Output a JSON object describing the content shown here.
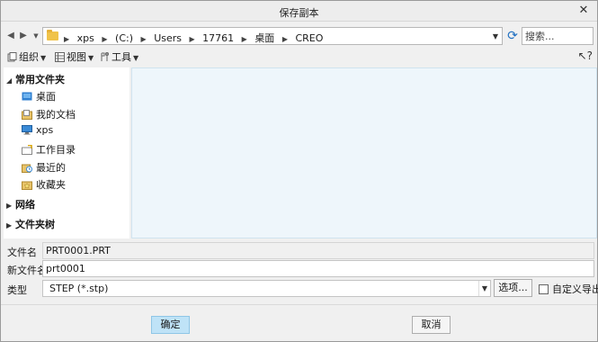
{
  "window": {
    "title": "保存副本",
    "close_glyph": "✕"
  },
  "address_bar": {
    "path": [
      "xps",
      "(C:)",
      "Users",
      "17761",
      "桌面",
      "CREO"
    ],
    "search_placeholder": "搜索..."
  },
  "toolbar": {
    "organize_label": "组织",
    "view_label": "视图",
    "tools_label": "工具"
  },
  "sidebar": {
    "favorites_label": "常用文件夹",
    "items": [
      {
        "label": "桌面",
        "icon": "desktop-icon"
      },
      {
        "label": "我的文档",
        "icon": "documents-icon"
      },
      {
        "label": "xps",
        "icon": "computer-icon"
      },
      {
        "label": "工作目录",
        "icon": "working-directory-icon"
      },
      {
        "label": "最近的",
        "icon": "recent-icon"
      },
      {
        "label": "收藏夹",
        "icon": "favorites-icon"
      }
    ],
    "network_label": "网络",
    "folder_tree_label": "文件夹树"
  },
  "form": {
    "filename_label": "文件名",
    "filename_value": "PRT0001.PRT",
    "new_filename_label": "新文件名",
    "new_filename_value": "prt0001",
    "type_label": "类型",
    "type_value": "STEP (*.stp)",
    "options_button": "选项...",
    "custom_export_label": "自定义导出",
    "custom_export_checked": false
  },
  "buttons": {
    "ok_label": "确定",
    "cancel_label": "取消"
  },
  "colors": {
    "accent": "#bfe3f7",
    "content_bg": "#eef6fb"
  }
}
